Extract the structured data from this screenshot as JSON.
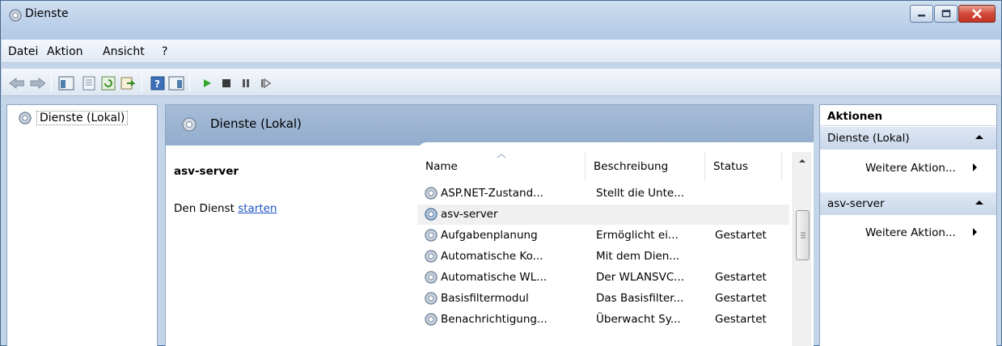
{
  "window": {
    "title": "Dienste"
  },
  "menu": [
    "Datei",
    "Aktion",
    "Ansicht",
    "?"
  ],
  "toolbar": {
    "icons": [
      "back-arrow",
      "forward-arrow",
      "show-hide-console-tree",
      "properties",
      "refresh",
      "export-list",
      "help",
      "show-hide-action-pane",
      "start-service",
      "stop-service",
      "pause-service",
      "resume-service"
    ]
  },
  "tree": {
    "root": "Dienste (Lokal)"
  },
  "details": {
    "header": "Dienste (Lokal)",
    "selected_service": "asv-server",
    "action_prefix": "Den Dienst ",
    "action_link": "starten"
  },
  "services": {
    "columns": [
      "Name",
      "Beschreibung",
      "Status"
    ],
    "rows": [
      {
        "name": "ASP.NET-Zustand...",
        "description": "Stellt die Unte...",
        "status": ""
      },
      {
        "name": "asv-server",
        "description": "",
        "status": ""
      },
      {
        "name": "Aufgabenplanung",
        "description": "Ermöglicht ei...",
        "status": "Gestartet"
      },
      {
        "name": "Automatische Ko...",
        "description": "Mit dem Dien...",
        "status": ""
      },
      {
        "name": "Automatische WL...",
        "description": "Der WLANSVC...",
        "status": "Gestartet"
      },
      {
        "name": "Basisfiltermodul",
        "description": "Das Basisfilter...",
        "status": "Gestartet"
      },
      {
        "name": "Benachrichtigung...",
        "description": "Überwacht Sy...",
        "status": "Gestartet"
      }
    ]
  },
  "actions": {
    "title": "Aktionen",
    "groups": [
      {
        "label": "Dienste (Lokal)",
        "item": "Weitere Aktion..."
      },
      {
        "label": "asv-server",
        "item": "Weitere Aktion..."
      }
    ]
  },
  "colors": {
    "accent": "#93adcd",
    "link": "#1a52c4",
    "close_button": "#c23323"
  }
}
